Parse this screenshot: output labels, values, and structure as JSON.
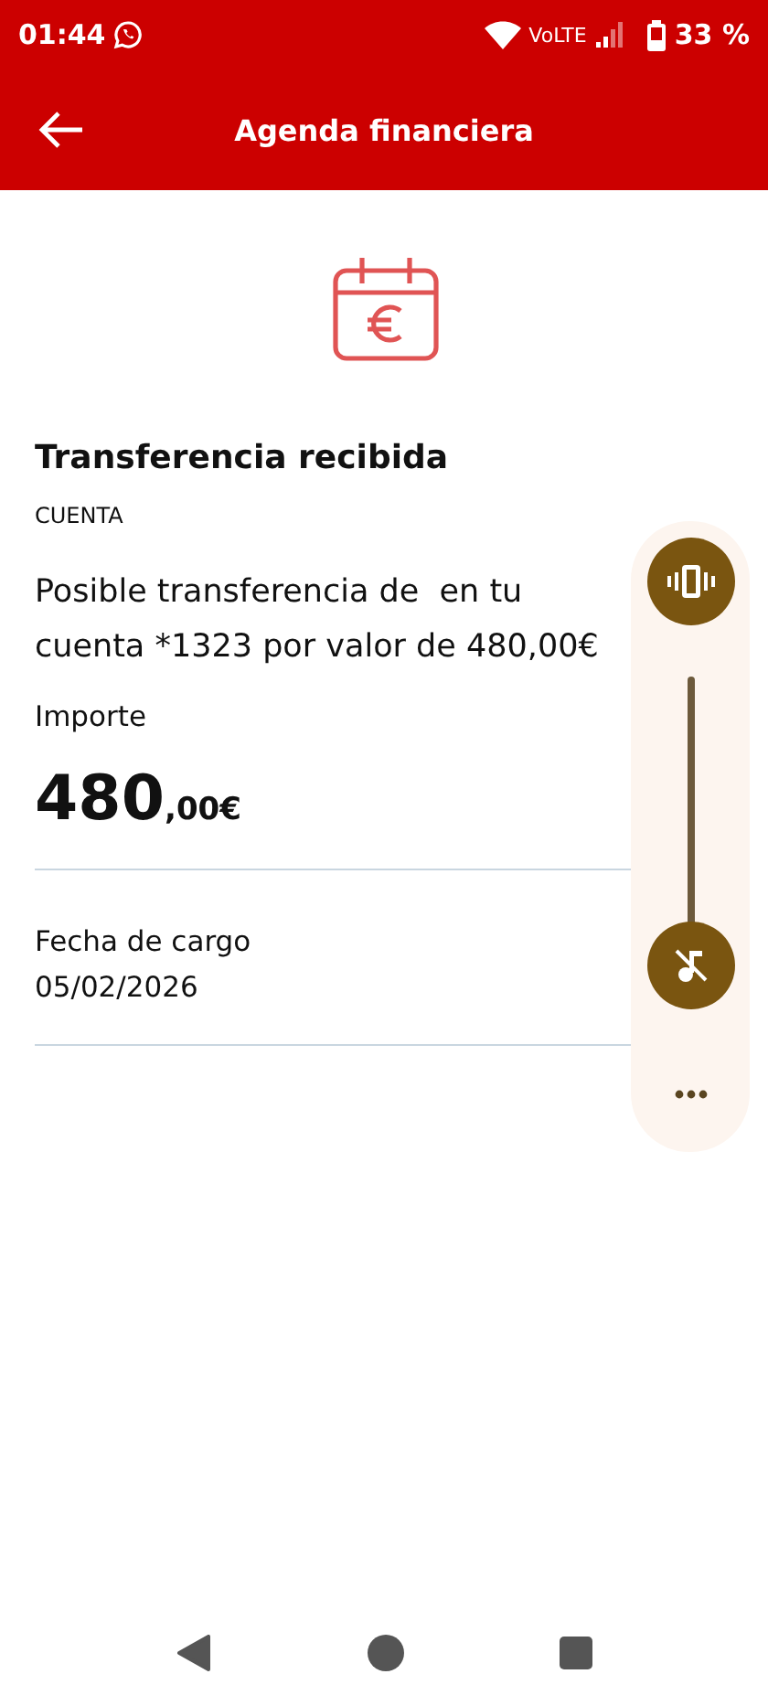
{
  "status_bar": {
    "time": "01:44",
    "network": "VoLTE",
    "battery": "33 %"
  },
  "app_bar": {
    "title": "Agenda financiera"
  },
  "detail": {
    "title": "Transferencia recibida",
    "account_label": "CUENTA",
    "description": "Posible transferencia de  en tu cuenta *1323 por valor de 480,00€",
    "amount_label": "Importe",
    "amount_integer": "480",
    "amount_decimals": ",00€",
    "date_label": "Fecha de cargo",
    "date": "05/02/2026"
  },
  "volume_panel": {
    "level": 0
  }
}
